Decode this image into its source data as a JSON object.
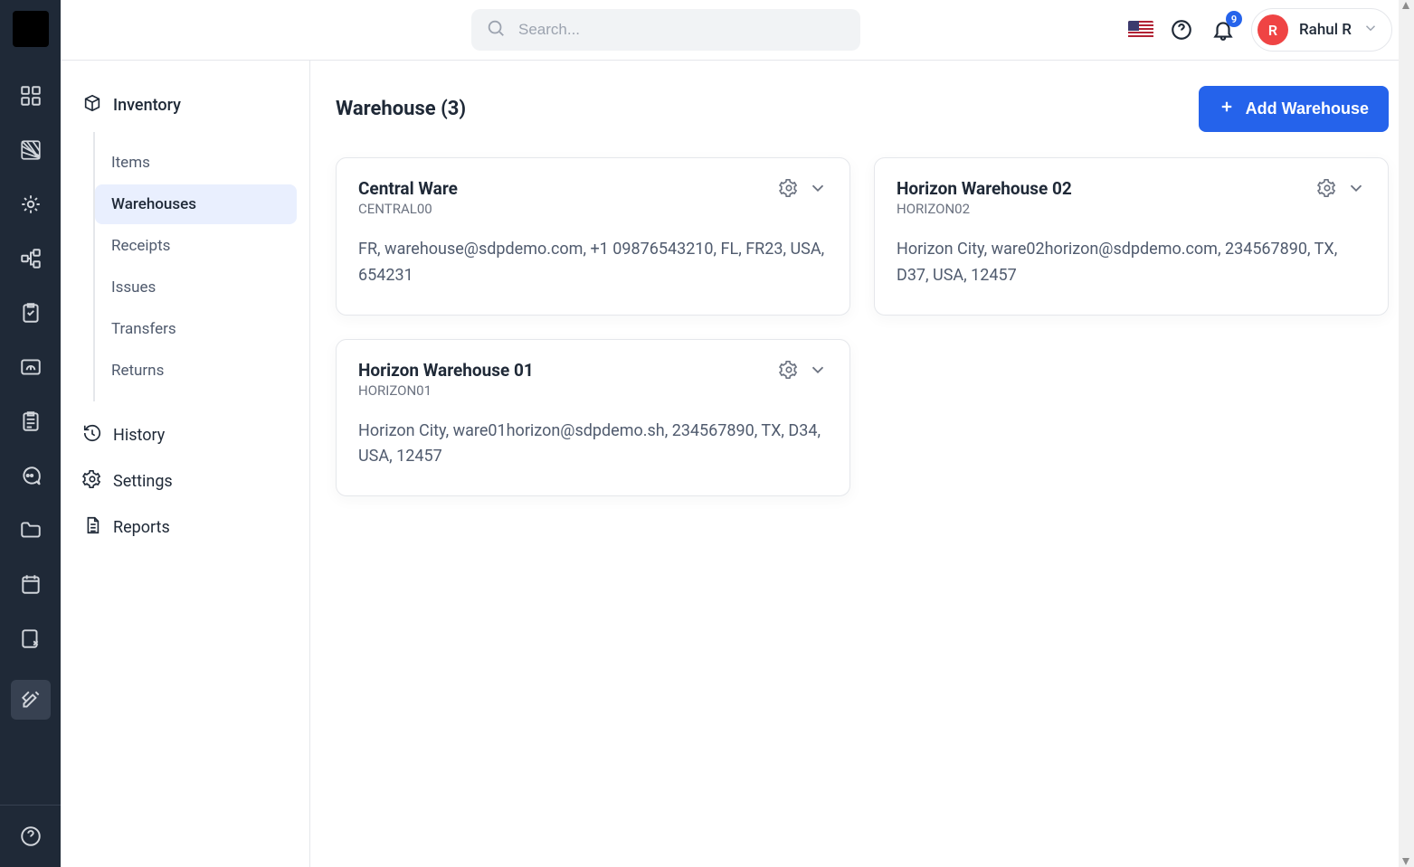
{
  "header": {
    "search_placeholder": "Search...",
    "notifications_count": "9",
    "user": {
      "initial": "R",
      "name": "Rahul R"
    }
  },
  "sidebar": {
    "group": "Inventory",
    "sub_items": [
      {
        "label": "Items",
        "active": false
      },
      {
        "label": "Warehouses",
        "active": true
      },
      {
        "label": "Receipts",
        "active": false
      },
      {
        "label": "Issues",
        "active": false
      },
      {
        "label": "Transfers",
        "active": false
      },
      {
        "label": "Returns",
        "active": false
      }
    ],
    "items": [
      {
        "label": "History",
        "icon": "history"
      },
      {
        "label": "Settings",
        "icon": "gear"
      },
      {
        "label": "Reports",
        "icon": "document"
      }
    ]
  },
  "main": {
    "title": "Warehouse (3)",
    "add_label": "Add Warehouse",
    "cards": [
      {
        "title": "Central Ware",
        "code": "CENTRAL00",
        "details": "FR, warehouse@sdpdemo.com, +1 09876543210, FL, FR23, USA, 654231"
      },
      {
        "title": "Horizon Warehouse 02",
        "code": "HORIZON02",
        "details": "Horizon City, ware02horizon@sdpdemo.com, 234567890, TX, D37, USA, 12457"
      },
      {
        "title": "Horizon Warehouse 01",
        "code": "HORIZON01",
        "details": "Horizon City, ware01horizon@sdpdemo.sh, 234567890, TX, D34, USA, 12457"
      }
    ]
  }
}
